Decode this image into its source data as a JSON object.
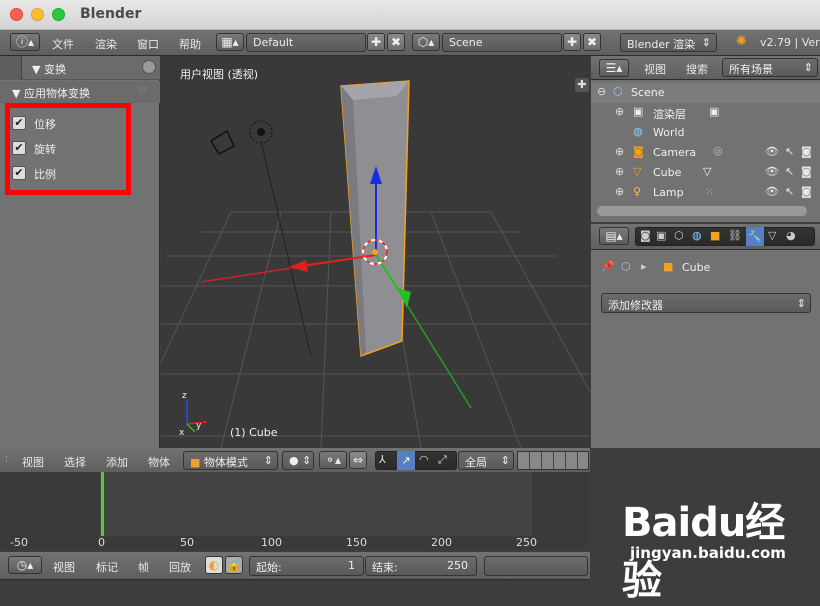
{
  "app": {
    "title": "Blender"
  },
  "info_header": {
    "menus": [
      "文件",
      "渲染",
      "窗口",
      "帮助"
    ],
    "layout": "Default",
    "scene": "Scene",
    "engine": "Blender 渲染",
    "version": "v2.79 | Ver"
  },
  "toolshelf": {
    "panel1_title": "▼ 变换",
    "panel2_title": "▼ 应用物体变换",
    "checkboxes": [
      {
        "label": "位移",
        "checked": true
      },
      {
        "label": "旋转",
        "checked": true
      },
      {
        "label": "比例",
        "checked": true
      }
    ],
    "highlight_color": "#ff0000"
  },
  "viewport": {
    "view_label": "用户视图 (透视)",
    "object_label": "(1) Cube",
    "axis_labels": {
      "x": "x",
      "y": "y",
      "z": "z"
    }
  },
  "view3d_header": {
    "menus": [
      "视图",
      "选择",
      "添加",
      "物体"
    ],
    "mode": "物体模式",
    "orientation": "全局"
  },
  "outliner": {
    "header_menus": [
      "视图",
      "搜索"
    ],
    "filter": "所有场景",
    "items": [
      {
        "label": "Scene",
        "icon": "scene-icon"
      },
      {
        "label": "渲染层",
        "icon": "render-layer-icon"
      },
      {
        "label": "World",
        "icon": "world-icon"
      },
      {
        "label": "Camera",
        "icon": "camera-icon"
      },
      {
        "label": "Cube",
        "icon": "mesh-icon"
      },
      {
        "label": "Lamp",
        "icon": "lamp-icon"
      }
    ]
  },
  "properties": {
    "breadcrumb_object": "Cube",
    "add_modifier": "添加修改器"
  },
  "timeline": {
    "ticks": [
      "-50",
      "0",
      "50",
      "100",
      "150",
      "200",
      "250"
    ],
    "current_frame": 0,
    "menus": [
      "视图",
      "标记",
      "帧",
      "回放"
    ],
    "start_label": "起始:",
    "start_value": "1",
    "end_label": "结束:",
    "end_value": "250"
  },
  "watermark": {
    "brand": "Baidu经验",
    "url": "jingyan.baidu.com"
  }
}
